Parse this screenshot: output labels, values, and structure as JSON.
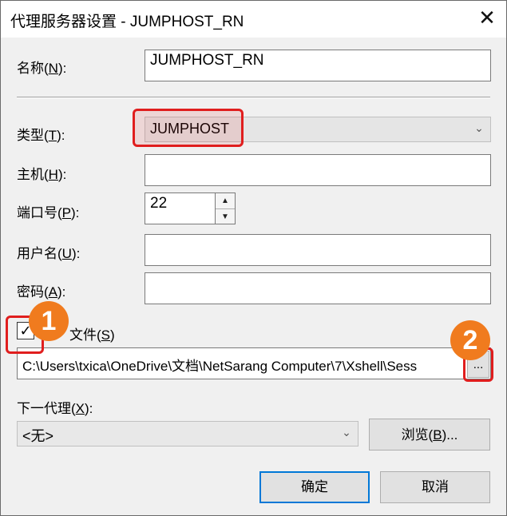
{
  "window": {
    "title": "代理服务器设置 - JUMPHOST_RN",
    "close_glyph": "✕"
  },
  "form": {
    "name": {
      "label_text": "名称(",
      "label_key": "N",
      "label_end": "):",
      "value": "JUMPHOST_RN"
    },
    "type": {
      "label_text": "类型(",
      "label_key": "T",
      "label_end": "):",
      "value": "JUMPHOST"
    },
    "host": {
      "label_text": "主机(",
      "label_key": "H",
      "label_end": "):",
      "value": ""
    },
    "port": {
      "label_text": "端口号(",
      "label_key": "P",
      "label_end": "):",
      "value": "22"
    },
    "username": {
      "label_text": "用户名(",
      "label_key": "U",
      "label_end": "):",
      "value": ""
    },
    "password": {
      "label_text": "密码(",
      "label_key": "A",
      "label_end": "):",
      "value": ""
    },
    "session_file": {
      "checked": true,
      "label_text": "文件(",
      "label_key": "S",
      "label_end": ")",
      "path": "C:\\Users\\txica\\OneDrive\\文档\\NetSarang Computer\\7\\Xshell\\Sess",
      "browse_label": "..."
    },
    "next_proxy": {
      "label_text": "下一代理(",
      "label_key": "X",
      "label_end": "):",
      "value": "<无>",
      "browse_text": "浏览(",
      "browse_key": "B",
      "browse_end": ")..."
    }
  },
  "buttons": {
    "ok": "确定",
    "cancel": "取消"
  },
  "annotations": {
    "badge1": "1",
    "badge2": "2"
  },
  "colors": {
    "highlight": "#e01e1e",
    "badge": "#f07b1e",
    "accent": "#0078d7"
  }
}
